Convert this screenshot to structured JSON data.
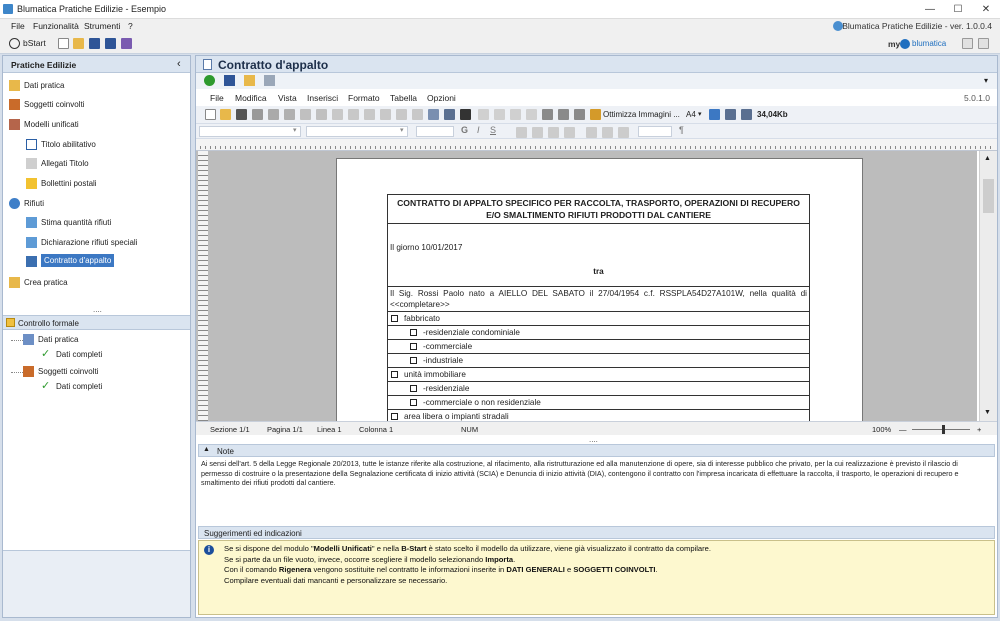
{
  "window": {
    "title": "Blumatica Pratiche Edilizie - Esempio",
    "version": "Blumatica Pratiche Edilizie - ver. 1.0.0.4"
  },
  "menu": [
    "File",
    "Funzionalità",
    "Strumenti",
    "?"
  ],
  "toolbar": {
    "bstart": "bStart",
    "brand_my": "my",
    "brand_name": "blumatica"
  },
  "left_panel": {
    "title": "Pratiche Edilizie",
    "collapse": "‹",
    "items": [
      {
        "label": "Dati pratica",
        "icon": "folder-icon"
      },
      {
        "label": "Soggetti coinvolti",
        "icon": "people-icon"
      },
      {
        "label": "Modelli unificati",
        "icon": "book-icon"
      },
      {
        "label": "Titolo abilitativo",
        "icon": "document-icon"
      },
      {
        "label": "Allegati Titolo",
        "icon": "attachment-icon"
      },
      {
        "label": "Bollettini postali",
        "icon": "postal-icon"
      },
      {
        "label": "Rifiuti",
        "icon": "recycle-icon"
      },
      {
        "label": "Stima quantità rifiuti",
        "icon": "chart-icon"
      },
      {
        "label": "Dichiarazione rifiuti speciali",
        "icon": "chart-icon"
      },
      {
        "label": "Contratto d'appalto",
        "icon": "contract-icon"
      },
      {
        "label": "Crea pratica",
        "icon": "create-icon"
      }
    ],
    "grip": "....",
    "controllo_formale": {
      "title": "Controllo formale",
      "tree": [
        {
          "label": "Dati pratica",
          "child": "Dati completi"
        },
        {
          "label": "Soggetti coinvolti",
          "child": "Dati completi"
        }
      ]
    }
  },
  "document": {
    "title": "Contratto d'appalto",
    "editor_menu": [
      "File",
      "Modifica",
      "Vista",
      "Inserisci",
      "Formato",
      "Tabella",
      "Opzioni"
    ],
    "editor_version": "5.0.1.0",
    "optimize_label": "Ottimizza Immagini ...",
    "page_size": "A4",
    "file_size": "34,04Kb",
    "heading": "CONTRATTO DI APPALTO  SPECIFICO PER RACCOLTA, TRASPORTO, OPERAZIONI DI RECUPERO E/O SMALTIMENTO RIFIUTI PRODOTTI DAL CANTIERE",
    "date_line": "Il giorno 10/01/2017",
    "tra": "tra",
    "party": "Il Sig. Rossi Paolo nato a AIELLO DEL SABATO il 27/04/1954 c.f. RSSPLA54D27A101W, nella qualità di <<completare>>",
    "rows": [
      {
        "label": "fabbricato",
        "indent": 0
      },
      {
        "label": "-residenziale condominiale",
        "indent": 1
      },
      {
        "label": "-commerciale",
        "indent": 1
      },
      {
        "label": "-industriale",
        "indent": 1
      },
      {
        "label": "unità immobiliare",
        "indent": 0
      },
      {
        "label": "-residenziale",
        "indent": 1
      },
      {
        "label": "-commerciale o non residenziale",
        "indent": 1
      },
      {
        "label": "area libera o impianti stradali",
        "indent": 0
      }
    ]
  },
  "status": {
    "sezione": "Sezione 1/1",
    "pagina": "Pagina 1/1",
    "linea": "Linea 1",
    "colonna": "Colonna 1",
    "num": "NUM",
    "zoom": "100%",
    "zoom_level": 0.55
  },
  "notes": {
    "title": "Note",
    "text": "Ai sensi dell'art. 5 della Legge Regionale 20/2013, tutte le istanze riferite alla costruzione, al rifacimento, alla ristrutturazione ed alla manutenzione di opere, sia di interesse pubblico che privato, per la cui realizzazione è previsto il rilascio di permesso di costruire o la presentazione della Segnalazione certificata di inizio attività (SCIA) e Denuncia di inizio attività (DIA), contengono il contratto con l'impresa incaricata di effettuare la raccolta, il trasporto, le operazioni di recupero e smaltimento dei rifiuti prodotti dal cantiere."
  },
  "suggestions": {
    "title": "Suggerimenti ed indicazioni",
    "l1a": "Se si dispone del modulo \"",
    "l1b": "Modelli Unificati",
    "l1c": "\" e nella ",
    "l1d": "B-Start",
    "l1e": " è stato scelto il modello da utilizzare, viene già visualizzato il contratto da compilare.",
    "l2a": "Se si parte da un file vuoto, invece, occorre scegliere il modello selezionando ",
    "l2b": "Importa",
    "l2c": ".",
    "l3a": "Con il comando ",
    "l3b": "Rigenera",
    "l3c": " vengono sostituite nel contratto le informazioni inserite in ",
    "l3d": "DATI GENERALI",
    "l3e": " e ",
    "l3f": "SOGGETTI COINVOLTI",
    "l3g": ".",
    "l4": "Compilare eventuali dati mancanti e personalizzare se necessario."
  }
}
